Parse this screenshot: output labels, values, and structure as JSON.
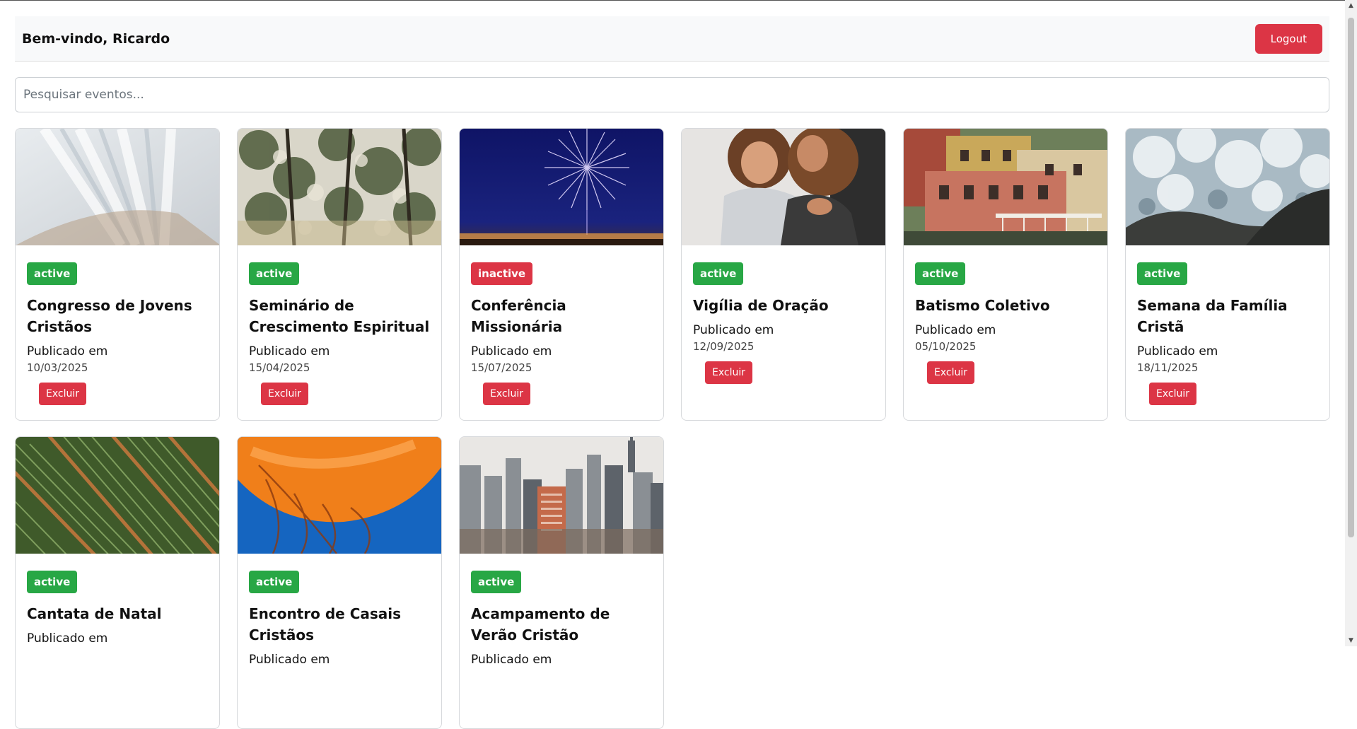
{
  "header": {
    "welcome": "Bem-vindo, Ricardo",
    "logout_label": "Logout"
  },
  "search": {
    "placeholder": "Pesquisar eventos...",
    "value": ""
  },
  "labels": {
    "published": "Publicado em",
    "delete": "Excluir"
  },
  "colors": {
    "danger": "#dc3545",
    "success": "#28a745"
  },
  "events": [
    {
      "status": "active",
      "title": "Congresso de Jovens Cristãos",
      "date": "10/03/2025",
      "image": "light-rays"
    },
    {
      "status": "active",
      "title": "Seminário de Crescimento Espiritual",
      "date": "15/04/2025",
      "image": "forest-trees"
    },
    {
      "status": "inactive",
      "title": "Conferência Missionária",
      "date": "15/07/2025",
      "image": "fireworks"
    },
    {
      "status": "active",
      "title": "Vigília de Oração",
      "date": "12/09/2025",
      "image": "mother-child"
    },
    {
      "status": "active",
      "title": "Batismo Coletivo",
      "date": "05/10/2025",
      "image": "colorful-houses"
    },
    {
      "status": "active",
      "title": "Semana da Família Cristã",
      "date": "18/11/2025",
      "image": "ocean-wave"
    },
    {
      "status": "active",
      "title": "Cantata de Natal",
      "date": "",
      "image": "crop-rows"
    },
    {
      "status": "active",
      "title": "Encontro de Casais Cristãos",
      "date": "",
      "image": "jellyfish"
    },
    {
      "status": "active",
      "title": "Acampamento de Verão Cristão",
      "date": "",
      "image": "city-skyline"
    }
  ]
}
